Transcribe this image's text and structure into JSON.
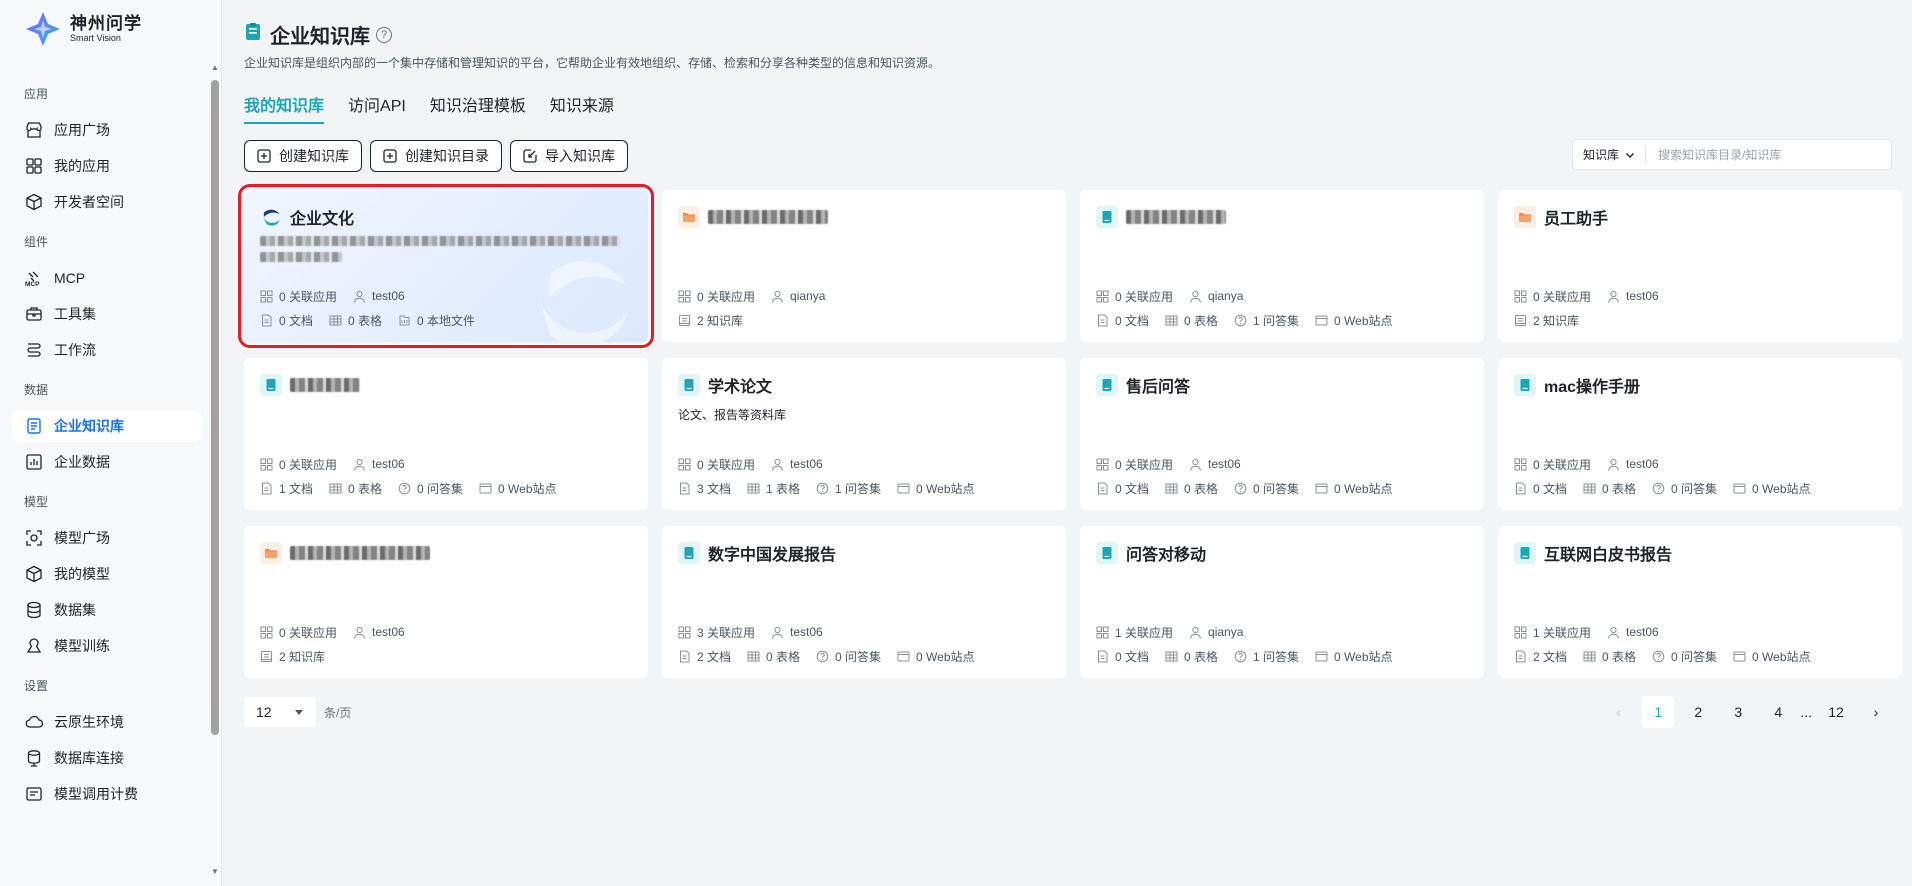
{
  "brand": {
    "name_cn": "神州问学",
    "name_en": "Smart Vision"
  },
  "sidebar": {
    "sections": [
      {
        "label": "应用",
        "items": [
          {
            "label": "应用广场",
            "icon": "store-icon"
          },
          {
            "label": "我的应用",
            "icon": "apps-grid-icon"
          },
          {
            "label": "开发者空间",
            "icon": "cube-icon"
          }
        ]
      },
      {
        "label": "组件",
        "items": [
          {
            "label": "MCP",
            "icon": "mcp-icon"
          },
          {
            "label": "工具集",
            "icon": "toolbox-icon"
          },
          {
            "label": "工作流",
            "icon": "workflow-icon"
          }
        ]
      },
      {
        "label": "数据",
        "items": [
          {
            "label": "企业知识库",
            "icon": "knowledge-base-icon",
            "active": true
          },
          {
            "label": "企业数据",
            "icon": "bar-chart-icon"
          }
        ]
      },
      {
        "label": "模型",
        "items": [
          {
            "label": "模型广场",
            "icon": "model-square-icon"
          },
          {
            "label": "我的模型",
            "icon": "model-cube-icon"
          },
          {
            "label": "数据集",
            "icon": "database-icon"
          },
          {
            "label": "模型训练",
            "icon": "training-icon"
          }
        ]
      },
      {
        "label": "设置",
        "items": [
          {
            "label": "云原生环境",
            "icon": "cloud-icon"
          },
          {
            "label": "数据库连接",
            "icon": "db-connect-icon"
          },
          {
            "label": "模型调用计费",
            "icon": "billing-icon"
          }
        ]
      }
    ]
  },
  "header": {
    "title": "企业知识库",
    "help": "?",
    "description": "企业知识库是组织内部的一个集中存储和管理知识的平台，它帮助企业有效地组织、存储、检索和分享各种类型的信息和知识资源。"
  },
  "tabs": [
    {
      "label": "我的知识库",
      "active": true
    },
    {
      "label": "访问API"
    },
    {
      "label": "知识治理模板"
    },
    {
      "label": "知识来源"
    }
  ],
  "actions": {
    "create_kb": "创建知识库",
    "create_dir": "创建知识目录",
    "import_kb": "导入知识库"
  },
  "search": {
    "type": "知识库",
    "placeholder": "搜索知识库目录/知识库"
  },
  "cards": [
    {
      "title": "企业文化",
      "icon": "brand",
      "highlight": true,
      "desc_blurred": true,
      "linked_apps": "0 关联应用",
      "owner": "test06",
      "stats": [
        {
          "icon": "doc-icon",
          "text": "0 文档"
        },
        {
          "icon": "table-icon",
          "text": "0 表格"
        },
        {
          "icon": "local-file-icon",
          "text": "0 本地文件"
        }
      ]
    },
    {
      "title": "",
      "title_blurred": true,
      "icon": "folder",
      "linked_apps": "0 关联应用",
      "owner": "qianya",
      "stats": [
        {
          "icon": "kb-icon",
          "text": "2 知识库"
        }
      ]
    },
    {
      "title": "",
      "title_blurred": true,
      "icon": "book",
      "linked_apps": "0 关联应用",
      "owner": "qianya",
      "stats": [
        {
          "icon": "doc-icon",
          "text": "0 文档"
        },
        {
          "icon": "table-icon",
          "text": "0 表格"
        },
        {
          "icon": "qa-icon",
          "text": "1 问答集"
        },
        {
          "icon": "web-icon",
          "text": "0 Web站点"
        }
      ]
    },
    {
      "title": "员工助手",
      "icon": "folder",
      "linked_apps": "0 关联应用",
      "owner": "test06",
      "stats": [
        {
          "icon": "kb-icon",
          "text": "2 知识库"
        }
      ]
    },
    {
      "title": "",
      "title_blurred": true,
      "icon": "book",
      "linked_apps": "0 关联应用",
      "owner": "test06",
      "stats": [
        {
          "icon": "doc-icon",
          "text": "1 文档"
        },
        {
          "icon": "table-icon",
          "text": "0 表格"
        },
        {
          "icon": "qa-icon",
          "text": "0 问答集"
        },
        {
          "icon": "web-icon",
          "text": "0 Web站点"
        }
      ]
    },
    {
      "title": "学术论文",
      "icon": "book",
      "desc": "论文、报告等资料库",
      "linked_apps": "0 关联应用",
      "owner": "test06",
      "stats": [
        {
          "icon": "doc-icon",
          "text": "3 文档"
        },
        {
          "icon": "table-icon",
          "text": "1 表格"
        },
        {
          "icon": "qa-icon",
          "text": "1 问答集"
        },
        {
          "icon": "web-icon",
          "text": "0 Web站点"
        }
      ]
    },
    {
      "title": "售后问答",
      "icon": "book",
      "linked_apps": "0 关联应用",
      "owner": "test06",
      "stats": [
        {
          "icon": "doc-icon",
          "text": "0 文档"
        },
        {
          "icon": "table-icon",
          "text": "0 表格"
        },
        {
          "icon": "qa-icon",
          "text": "0 问答集"
        },
        {
          "icon": "web-icon",
          "text": "0 Web站点"
        }
      ]
    },
    {
      "title": "mac操作手册",
      "icon": "book",
      "linked_apps": "0 关联应用",
      "owner": "test06",
      "stats": [
        {
          "icon": "doc-icon",
          "text": "0 文档"
        },
        {
          "icon": "table-icon",
          "text": "0 表格"
        },
        {
          "icon": "qa-icon",
          "text": "0 问答集"
        },
        {
          "icon": "web-icon",
          "text": "0 Web站点"
        }
      ]
    },
    {
      "title": "",
      "title_blurred": true,
      "icon": "folder",
      "linked_apps": "0 关联应用",
      "owner": "test06",
      "stats": [
        {
          "icon": "kb-icon",
          "text": "2 知识库"
        }
      ]
    },
    {
      "title": "数字中国发展报告",
      "icon": "book",
      "linked_apps": "3 关联应用",
      "owner": "test06",
      "stats": [
        {
          "icon": "doc-icon",
          "text": "2 文档"
        },
        {
          "icon": "table-icon",
          "text": "0 表格"
        },
        {
          "icon": "qa-icon",
          "text": "0 问答集"
        },
        {
          "icon": "web-icon",
          "text": "0 Web站点"
        }
      ]
    },
    {
      "title": "问答对移动",
      "icon": "book",
      "linked_apps": "1 关联应用",
      "owner": "qianya",
      "stats": [
        {
          "icon": "doc-icon",
          "text": "0 文档"
        },
        {
          "icon": "table-icon",
          "text": "0 表格"
        },
        {
          "icon": "qa-icon",
          "text": "1 问答集"
        },
        {
          "icon": "web-icon",
          "text": "0 Web站点"
        }
      ]
    },
    {
      "title": "互联网白皮书报告",
      "icon": "book",
      "linked_apps": "1 关联应用",
      "owner": "test06",
      "stats": [
        {
          "icon": "doc-icon",
          "text": "2 文档"
        },
        {
          "icon": "table-icon",
          "text": "0 表格"
        },
        {
          "icon": "qa-icon",
          "text": "0 问答集"
        },
        {
          "icon": "web-icon",
          "text": "0 Web站点"
        }
      ]
    }
  ],
  "pagination": {
    "page_size": "12",
    "unit": "条/页",
    "pages": [
      "1",
      "2",
      "3",
      "4"
    ],
    "ellipsis": "...",
    "last_page": "12",
    "current": "1",
    "prev": "‹",
    "next": "›"
  },
  "colors": {
    "accent": "#1aa7b8",
    "active_nav": "#1f6fe5",
    "highlight_border": "#e11d2a"
  }
}
